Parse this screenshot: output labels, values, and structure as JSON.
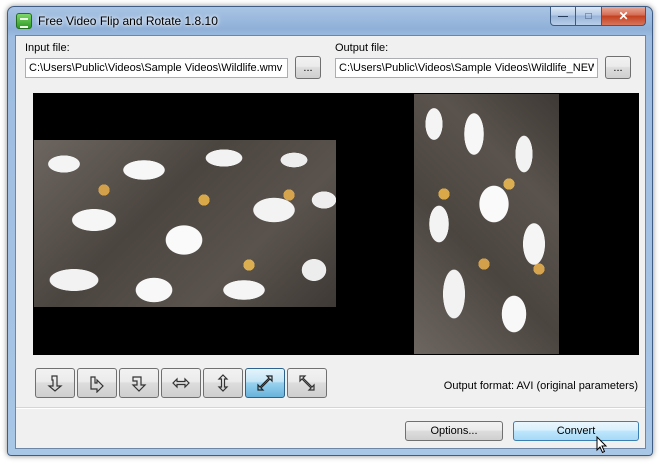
{
  "window": {
    "title": "Free Video Flip and Rotate 1.8.10",
    "icon": "app-icon",
    "caption": {
      "minimize": "minimize-icon",
      "maximize": "maximize-icon",
      "close": "close-icon"
    }
  },
  "input": {
    "label": "Input file:",
    "value": "C:\\Users\\Public\\Videos\\Sample Videos\\Wildlife.wmv",
    "browse_label": "..."
  },
  "output": {
    "label": "Output file:",
    "value": "C:\\Users\\Public\\Videos\\Sample Videos\\Wildlife_NEW.avi",
    "browse_label": "..."
  },
  "toolbar": {
    "buttons": [
      {
        "name": "rotate-90-counterclockwise",
        "icon": "rotate-ccw-icon",
        "active": false
      },
      {
        "name": "rotate-90-clockwise",
        "icon": "rotate-cw-icon",
        "active": false
      },
      {
        "name": "rotate-180",
        "icon": "rotate-180-icon",
        "active": false
      },
      {
        "name": "flip-horizontal",
        "icon": "flip-horizontal-icon",
        "active": false
      },
      {
        "name": "flip-vertical",
        "icon": "flip-vertical-icon",
        "active": false
      },
      {
        "name": "transpose",
        "icon": "diagonal-up-icon",
        "active": true
      },
      {
        "name": "transverse",
        "icon": "diagonal-down-icon",
        "active": false
      }
    ],
    "output_format": "Output format: AVI (original parameters)"
  },
  "footer": {
    "options_label": "Options...",
    "convert_label": "Convert"
  },
  "colors": {
    "accent": "#98d1ef",
    "preview_background": "#000000"
  }
}
